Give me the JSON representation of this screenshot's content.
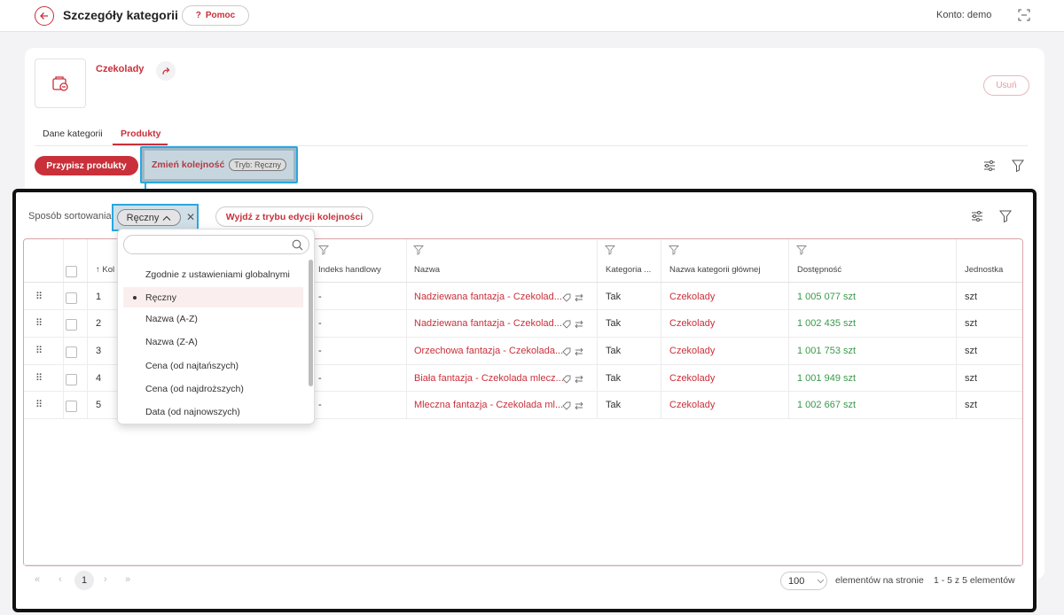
{
  "header": {
    "title": "Szczegóły kategorii",
    "help_label": "Pomoc",
    "account": "Konto: demo"
  },
  "category": {
    "name": "Czekolady",
    "delete_label": "Usuń"
  },
  "tabs": [
    {
      "label": "Dane kategorii"
    },
    {
      "label": "Produkty",
      "active": true
    }
  ],
  "toolbar": {
    "assign_label": "Przypisz produkty",
    "reorder_label": "Zmień kolejność",
    "mode_label": "Tryb: Ręczny"
  },
  "sorting": {
    "label": "Sposób sortowania:",
    "selected": "Ręczny",
    "exit_label": "Wyjdź z trybu edycji kolejności",
    "options": [
      "Zgodnie z ustawieniami globalnymi",
      "Ręczny",
      "Nazwa (A-Z)",
      "Nazwa (Z-A)",
      "Cena (od najtańszych)",
      "Cena (od najdroższych)",
      "Data (od najnowszych)"
    ]
  },
  "table": {
    "columns": {
      "order": "Kol",
      "trade_index": "Indeks handlowy",
      "name": "Nazwa",
      "category": "Kategoria ...",
      "main_category": "Nazwa kategorii głównej",
      "availability": "Dostępność",
      "unit": "Jednostka"
    },
    "rows": [
      {
        "order": "1",
        "trade_index": "-",
        "name": "Nadziewana fantazja - Czekolad...",
        "category": "Tak",
        "main_category": "Czekolady",
        "availability": "1 005 077 szt",
        "unit": "szt"
      },
      {
        "order": "2",
        "trade_index": "-",
        "name": "Nadziewana fantazja - Czekolad...",
        "category": "Tak",
        "main_category": "Czekolady",
        "availability": "1 002 435 szt",
        "unit": "szt"
      },
      {
        "order": "3",
        "trade_index": "-",
        "name": "Orzechowa fantazja - Czekolada...",
        "category": "Tak",
        "main_category": "Czekolady",
        "availability": "1 001 753 szt",
        "unit": "szt"
      },
      {
        "order": "4",
        "trade_index": "-",
        "name": "Biała fantazja - Czekolada mlecz...",
        "category": "Tak",
        "main_category": "Czekolady",
        "availability": "1 001 949 szt",
        "unit": "szt"
      },
      {
        "order": "5",
        "trade_index": "-",
        "name": "Mleczna fantazja - Czekolada ml...",
        "category": "Tak",
        "main_category": "Czekolady",
        "availability": "1 002 667 szt",
        "unit": "szt"
      }
    ]
  },
  "pagination": {
    "current_page": "1",
    "per_page": "100",
    "per_page_label": "elementów na stronie",
    "range": "1 - 5 z 5 elementów"
  },
  "colors": {
    "accent": "#c9303a",
    "highlight": "#29a8e0",
    "available": "#3a9a4a"
  }
}
